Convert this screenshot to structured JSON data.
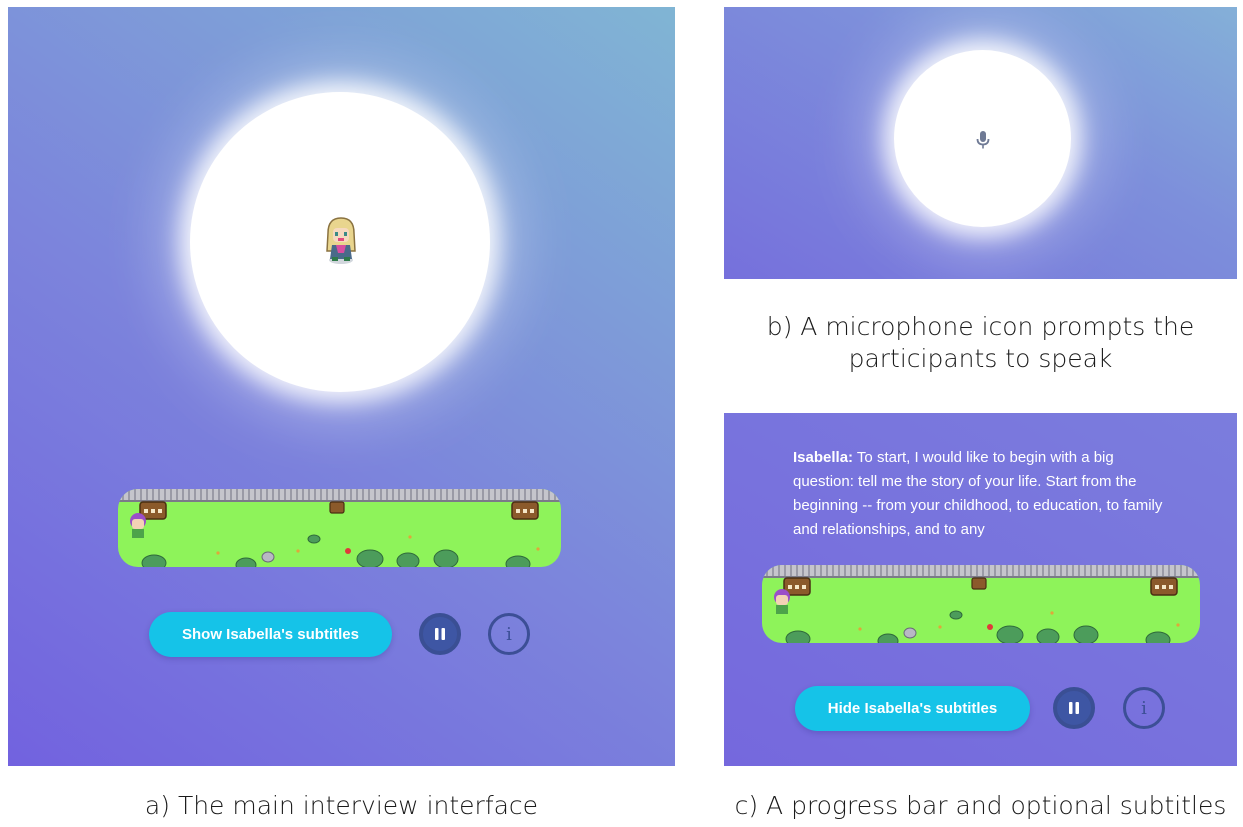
{
  "panel_a": {
    "caption": "a) The main interview interface",
    "subtitle_button_label": "Show Isabella's subtitles",
    "pause_icon": "pause-icon",
    "info_icon": "info-icon",
    "info_glyph": "i"
  },
  "panel_b": {
    "caption_line1": "b) A microphone icon prompts the",
    "caption_line2": "participants to speak",
    "mic_icon": "microphone-icon"
  },
  "panel_c": {
    "caption": "c) A progress bar and optional subtitles",
    "speaker": "Isabella:",
    "subtitle_text": " To start, I would like to begin with a big question: tell me the story of your life. Start from the beginning -- from your childhood, to education, to family and relationships, and to any",
    "subtitle_button_label": "Hide Isabella's subtitles",
    "pause_icon": "pause-icon",
    "info_icon": "info-icon",
    "info_glyph": "i"
  },
  "colors": {
    "subtitle_button": "#15c3e8",
    "round_button_border": "#3c4f96",
    "map_grass": "#8ef35a"
  }
}
